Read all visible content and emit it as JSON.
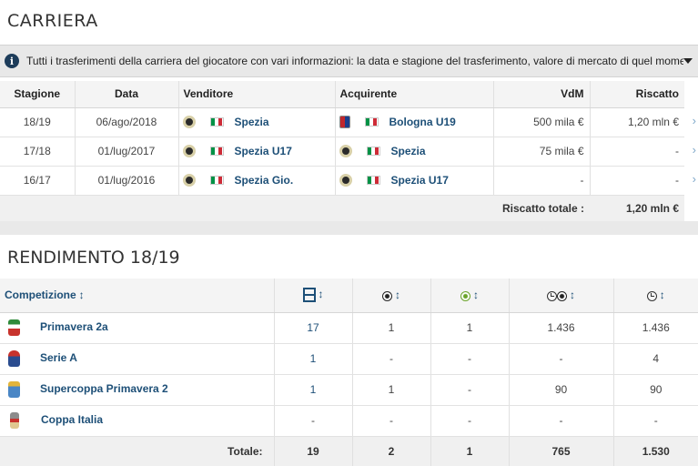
{
  "carriera": {
    "title": "CARRIERA",
    "info": "Tutti i trasferimenti della carriera del giocatore con vari informazioni: la data e stagione del trasferimento, valore di mercato di quel momento…",
    "headers": {
      "stagione": "Stagione",
      "data": "Data",
      "venditore": "Venditore",
      "acquirente": "Acquirente",
      "vdm": "VdM",
      "riscatto": "Riscatto"
    },
    "rows": [
      {
        "stagione": "18/19",
        "data": "06/ago/2018",
        "venditore": "Spezia",
        "acquirente": "Bologna U19",
        "vdm": "500 mila €",
        "riscatto": "1,20 mln €"
      },
      {
        "stagione": "17/18",
        "data": "01/lug/2017",
        "venditore": "Spezia U17",
        "acquirente": "Spezia",
        "vdm": "75 mila €",
        "riscatto": "-"
      },
      {
        "stagione": "16/17",
        "data": "01/lug/2016",
        "venditore": "Spezia Gio.",
        "acquirente": "Spezia U17",
        "vdm": "-",
        "riscatto": "-"
      }
    ],
    "total_label": "Riscatto totale :",
    "total_value": "1,20 mln €",
    "arrow": "›"
  },
  "rendimento": {
    "title": "RENDIMENTO 18/19",
    "header_competizione": "Competizione",
    "sort_glyph": "↕",
    "column_icons": [
      "field-icon",
      "ball-icon",
      "assist-ball-icon",
      "clock-ball-icon",
      "clock-icon"
    ],
    "rows": [
      {
        "competizione": "Primavera 2a",
        "presenze": "17",
        "gol": "1",
        "assist": "1",
        "min_gol": "1.436",
        "minuti": "1.436"
      },
      {
        "competizione": "Serie A",
        "presenze": "1",
        "gol": "-",
        "assist": "-",
        "min_gol": "-",
        "minuti": "4"
      },
      {
        "competizione": "Supercoppa Primavera 2",
        "presenze": "1",
        "gol": "1",
        "assist": "-",
        "min_gol": "90",
        "minuti": "90"
      },
      {
        "competizione": "Coppa Italia",
        "presenze": "-",
        "gol": "-",
        "assist": "-",
        "min_gol": "-",
        "minuti": "-"
      }
    ],
    "total_label": "Totale:",
    "totals": {
      "presenze": "19",
      "gol": "2",
      "assist": "1",
      "min_gol": "765",
      "minuti": "1.530"
    }
  },
  "colors": {
    "link": "#1d4f77",
    "header_bg": "#f4f4f4",
    "bar_bg": "#e8e8e8"
  }
}
